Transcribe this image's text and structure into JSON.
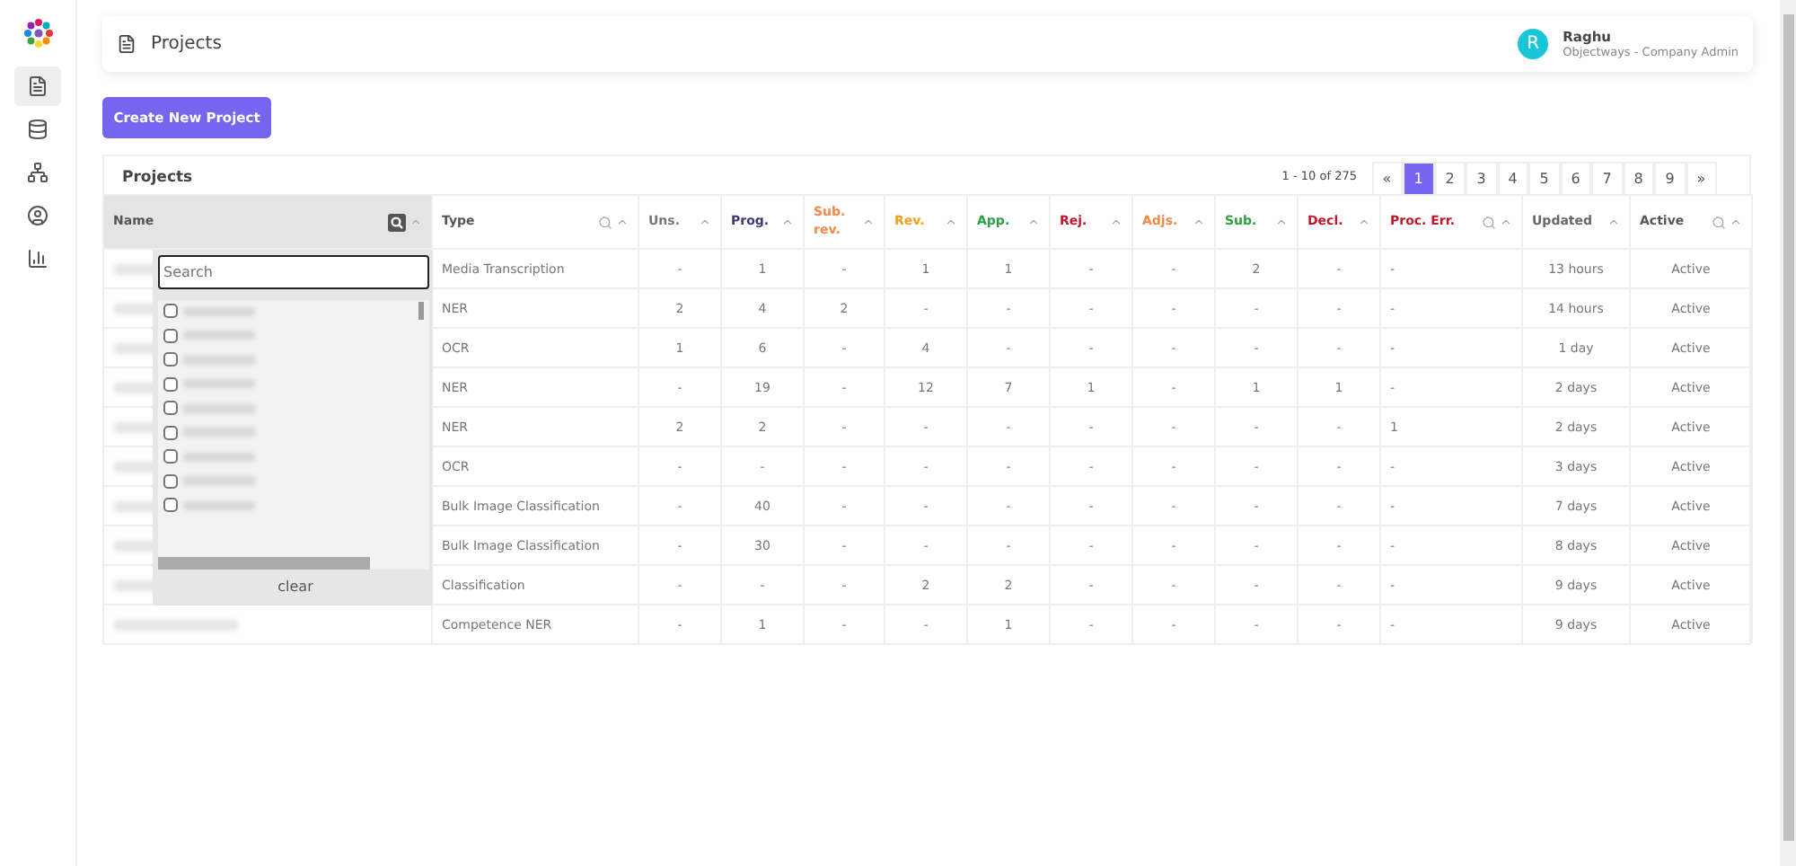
{
  "sidebar": {
    "items": [
      {
        "kind": "file",
        "selected": true
      },
      {
        "kind": "database",
        "selected": false
      },
      {
        "kind": "hierarchy",
        "selected": false
      },
      {
        "kind": "user",
        "selected": false
      },
      {
        "kind": "chart",
        "selected": false
      }
    ]
  },
  "header": {
    "title": "Projects",
    "user": {
      "initial": "R",
      "name": "Raghu",
      "role": "Objectways - Company Admin"
    }
  },
  "create_button": "Create New Project",
  "table": {
    "title": "Projects",
    "range": "1 - 10 of 275",
    "pagination": [
      {
        "label": "«",
        "selected": false
      },
      {
        "label": "1",
        "selected": true
      },
      {
        "label": "2",
        "selected": false
      },
      {
        "label": "3",
        "selected": false
      },
      {
        "label": "4",
        "selected": false
      },
      {
        "label": "5",
        "selected": false
      },
      {
        "label": "6",
        "selected": false
      },
      {
        "label": "7",
        "selected": false
      },
      {
        "label": "8",
        "selected": false
      },
      {
        "label": "9",
        "selected": false
      },
      {
        "label": "»",
        "selected": false
      }
    ],
    "columns": [
      {
        "label": "Name",
        "color": "#555555",
        "searchable": true,
        "filter_active": true
      },
      {
        "label": "Type",
        "color": "#555555",
        "searchable": true,
        "filter_active": false
      },
      {
        "label": "Uns.",
        "color": "#777777",
        "searchable": false,
        "filter_active": false
      },
      {
        "label": "Prog.",
        "color": "#3b3b7a",
        "searchable": false,
        "filter_active": false
      },
      {
        "label": "Sub. rev.",
        "color": "#f0894a",
        "searchable": false,
        "filter_active": false
      },
      {
        "label": "Rev.",
        "color": "#f0a020",
        "searchable": false,
        "filter_active": false
      },
      {
        "label": "App.",
        "color": "#2ea043",
        "searchable": false,
        "filter_active": false
      },
      {
        "label": "Rej.",
        "color": "#c0182b",
        "searchable": false,
        "filter_active": false
      },
      {
        "label": "Adjs.",
        "color": "#f0894a",
        "searchable": false,
        "filter_active": false
      },
      {
        "label": "Sub.",
        "color": "#2ea043",
        "searchable": false,
        "filter_active": false
      },
      {
        "label": "Decl.",
        "color": "#c0182b",
        "searchable": false,
        "filter_active": false
      },
      {
        "label": "Proc. Err.",
        "color": "#c0182b",
        "searchable": true,
        "filter_active": false
      },
      {
        "label": "Updated",
        "color": "#666666",
        "searchable": false,
        "filter_active": false
      },
      {
        "label": "Active",
        "color": "#555555",
        "searchable": true,
        "filter_active": false
      }
    ],
    "rows": [
      {
        "cells": [
          "",
          "Media Transcription",
          "-",
          "1",
          "-",
          "1",
          "1",
          "-",
          "-",
          "2",
          "-",
          "-",
          "13 hours",
          "Active"
        ]
      },
      {
        "cells": [
          "",
          "NER",
          "2",
          "4",
          "2",
          "-",
          "-",
          "-",
          "-",
          "-",
          "-",
          "-",
          "14 hours",
          "Active"
        ]
      },
      {
        "cells": [
          "",
          "OCR",
          "1",
          "6",
          "-",
          "4",
          "-",
          "-",
          "-",
          "-",
          "-",
          "-",
          "1 day",
          "Active"
        ]
      },
      {
        "cells": [
          "",
          "NER",
          "-",
          "19",
          "-",
          "12",
          "7",
          "1",
          "-",
          "1",
          "1",
          "-",
          "2 days",
          "Active"
        ]
      },
      {
        "cells": [
          "",
          "NER",
          "2",
          "2",
          "-",
          "-",
          "-",
          "-",
          "-",
          "-",
          "-",
          "1",
          "2 days",
          "Active"
        ]
      },
      {
        "cells": [
          "",
          "OCR",
          "-",
          "-",
          "-",
          "-",
          "-",
          "-",
          "-",
          "-",
          "-",
          "-",
          "3 days",
          "Active"
        ]
      },
      {
        "cells": [
          "",
          "Bulk Image Classification",
          "-",
          "40",
          "-",
          "-",
          "-",
          "-",
          "-",
          "-",
          "-",
          "-",
          "7 days",
          "Active"
        ]
      },
      {
        "cells": [
          "",
          "Bulk Image Classification",
          "-",
          "30",
          "-",
          "-",
          "-",
          "-",
          "-",
          "-",
          "-",
          "-",
          "8 days",
          "Active"
        ]
      },
      {
        "cells": [
          "",
          "Classification",
          "-",
          "-",
          "-",
          "2",
          "2",
          "-",
          "-",
          "-",
          "-",
          "-",
          "9 days",
          "Active"
        ]
      },
      {
        "cells": [
          "",
          "Competence NER",
          "-",
          "1",
          "-",
          "-",
          "1",
          "-",
          "-",
          "-",
          "-",
          "-",
          "9 days",
          "Active"
        ]
      }
    ],
    "name_filter": {
      "placeholder": "Search",
      "options": [
        {
          "checked": false
        },
        {
          "checked": false
        },
        {
          "checked": false
        },
        {
          "checked": false
        },
        {
          "checked": false
        },
        {
          "checked": false
        },
        {
          "checked": false
        },
        {
          "checked": false
        },
        {
          "checked": false
        }
      ],
      "clear": "clear"
    }
  }
}
